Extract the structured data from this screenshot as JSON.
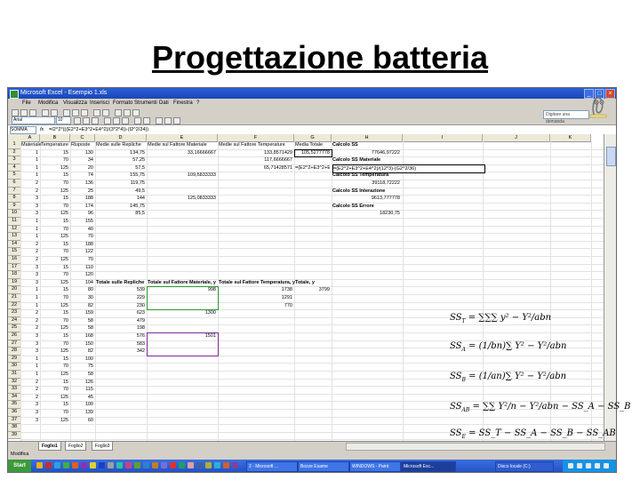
{
  "slide": {
    "title": "Progettazione batteria"
  },
  "window": {
    "title": "Microsoft Excel - Esempio 1.xls"
  },
  "menu": [
    "File",
    "Modifica",
    "Visualizza",
    "Inserisci",
    "Formato",
    "Strumenti",
    "Dati",
    "Finestra",
    "?"
  ],
  "help_box": "Digitare una domanda",
  "font_box": {
    "name": "Arial",
    "size": "10"
  },
  "formula_bar": {
    "name_box": "SOMMA",
    "fx": "fx",
    "formula": "=I2^2*(((E2^2+E3^2+E4^2)/(3*2*4))-(I2^2/24))"
  },
  "columns": [
    "A",
    "B",
    "C",
    "D",
    "E",
    "F",
    "G",
    "H",
    "I",
    "J",
    "K"
  ],
  "rows": [
    "1",
    "2",
    "3",
    "4",
    "5",
    "6",
    "7",
    "8",
    "9",
    "10",
    "11",
    "12",
    "13",
    "14",
    "15",
    "16",
    "17",
    "18",
    "19",
    "20",
    "21",
    "22",
    "23",
    "24",
    "25",
    "26",
    "27",
    "28",
    "29",
    "30",
    "31",
    "32",
    "33",
    "34",
    "35",
    "36",
    "37",
    "38",
    "39"
  ],
  "headers": {
    "a1": "Materiale",
    "b1": "Temperature",
    "c1": "Risposte",
    "d1": "Medie sulle Repliche",
    "e1": "Medie sul Fattore Materiale",
    "f1": "Medie sul Fattore Temperature",
    "g1": "Media Totale",
    "h1": "Calcolo SS",
    "h1_sub": "T"
  },
  "table": [
    [
      "1",
      "15",
      "130",
      "134,75",
      "33,16666667",
      "133,8571429",
      "105,5277778"
    ],
    [
      "1",
      "70",
      "34",
      "57,25",
      "",
      "117,6666667",
      ""
    ],
    [
      "1",
      "125",
      "20",
      "57,5",
      "",
      "65,71428571",
      "=(E2^2+E3^2+E4^2)"
    ],
    [
      "1",
      "15",
      "74",
      "155,75",
      "109,5833333",
      "",
      ""
    ],
    [
      "2",
      "70",
      "136",
      "119,75",
      "",
      "",
      ""
    ],
    [
      "2",
      "125",
      "25",
      "49,5",
      "",
      "",
      ""
    ],
    [
      "3",
      "15",
      "188",
      "144",
      "125,0833333",
      "",
      ""
    ],
    [
      "3",
      "70",
      "174",
      "145,75",
      "",
      "",
      ""
    ],
    [
      "3",
      "125",
      "96",
      "85,5",
      "",
      "",
      ""
    ],
    [
      "1",
      "15",
      "155",
      "",
      "",
      "",
      ""
    ],
    [
      "1",
      "70",
      "40",
      "",
      "",
      "",
      ""
    ],
    [
      "1",
      "125",
      "70",
      "",
      "",
      "",
      ""
    ],
    [
      "2",
      "15",
      "188",
      "",
      "",
      "",
      ""
    ],
    [
      "2",
      "70",
      "122",
      "",
      "",
      "",
      ""
    ],
    [
      "2",
      "125",
      "70",
      "",
      "",
      "",
      ""
    ],
    [
      "3",
      "15",
      "110",
      "",
      "",
      "",
      ""
    ],
    [
      "3",
      "70",
      "120",
      "",
      "",
      "",
      ""
    ],
    [
      "3",
      "125",
      "104",
      "",
      "",
      "",
      ""
    ],
    [
      "1",
      "15",
      "80",
      "",
      "",
      "",
      ""
    ],
    [
      "1",
      "70",
      "30",
      "",
      "",
      "",
      ""
    ],
    [
      "1",
      "125",
      "82",
      "",
      "",
      "",
      ""
    ],
    [
      "2",
      "15",
      "159",
      "",
      "",
      "",
      ""
    ],
    [
      "2",
      "70",
      "58",
      "",
      "",
      "",
      ""
    ],
    [
      "2",
      "125",
      "58",
      "",
      "",
      "",
      ""
    ],
    [
      "3",
      "15",
      "168",
      "",
      "",
      "",
      ""
    ],
    [
      "3",
      "70",
      "150",
      "",
      "",
      "",
      ""
    ],
    [
      "3",
      "125",
      "82",
      "",
      "",
      "",
      ""
    ],
    [
      "1",
      "15",
      "100",
      "",
      "",
      "",
      ""
    ],
    [
      "1",
      "70",
      "75",
      "",
      "",
      "",
      ""
    ],
    [
      "1",
      "125",
      "58",
      "",
      "",
      "",
      ""
    ],
    [
      "2",
      "15",
      "126",
      "",
      "",
      "",
      ""
    ],
    [
      "2",
      "70",
      "115",
      "",
      "",
      "",
      ""
    ],
    [
      "2",
      "125",
      "45",
      "",
      "",
      "",
      ""
    ],
    [
      "3",
      "15",
      "100",
      "",
      "",
      "",
      ""
    ],
    [
      "3",
      "70",
      "139",
      "",
      "",
      "",
      ""
    ],
    [
      "3",
      "125",
      "60",
      "",
      "",
      "",
      ""
    ]
  ],
  "ss_panel": {
    "t_value": "77646,97222",
    "materiale_label": "Calcolo SS Materiale",
    "materiale_formula": "=(E2^2+E3^2+E4^2)/(12*3)-(G2^2/36)",
    "temperatura_label": "Calcolo SS Temperatura",
    "temperatura_value": "39118,72222",
    "interazione_label": "Calcolo SS Interazione",
    "interazione_value": "9613,777778",
    "errore_label": "Calcolo SS Errore",
    "errore_value": "18230,75"
  },
  "totals_header": {
    "d": "Totale sulle Repliche",
    "e": "Totale sul Fattore Materiale, y",
    "f": "Totale sul Fattore Temperatura, y",
    "g": "Totale, y"
  },
  "totals": {
    "d": [
      "539",
      "229",
      "230",
      "623",
      "479",
      "198",
      "576",
      "583",
      "342"
    ],
    "e": [
      "998",
      "1300",
      "1501"
    ],
    "f": [
      "1738",
      "1291",
      "770"
    ],
    "g": "3799"
  },
  "sheet_tabs": [
    "Foglio1",
    "Foglio2",
    "Foglio3"
  ],
  "status": "Modifica",
  "taskbar": {
    "start": "Start",
    "tasks": [
      "2 - Microsoft ...",
      "Bozze Esame",
      "WINDOWS - Paint",
      "Microsoft Exc..."
    ],
    "tray": "Disco locale (C:)"
  },
  "equations": [
    {
      "lhs": "SS",
      "lhs_sub": "T",
      "rhs": " = ∑∑∑ y² − Y²/abn"
    },
    {
      "lhs": "SS",
      "lhs_sub": "A",
      "rhs": " = (1/bn)∑ Y² − Y²/abn"
    },
    {
      "lhs": "SS",
      "lhs_sub": "B",
      "rhs": " = (1/an)∑ Y² − Y²/abn"
    },
    {
      "lhs": "SS",
      "lhs_sub": "AB",
      "rhs": " = ∑∑ Y²/n − Y²/abn − SS_A − SS_B"
    },
    {
      "lhs": "SS",
      "lhs_sub": "E",
      "rhs": " = SS_T − SS_A − SS_B − SS_AB"
    }
  ]
}
